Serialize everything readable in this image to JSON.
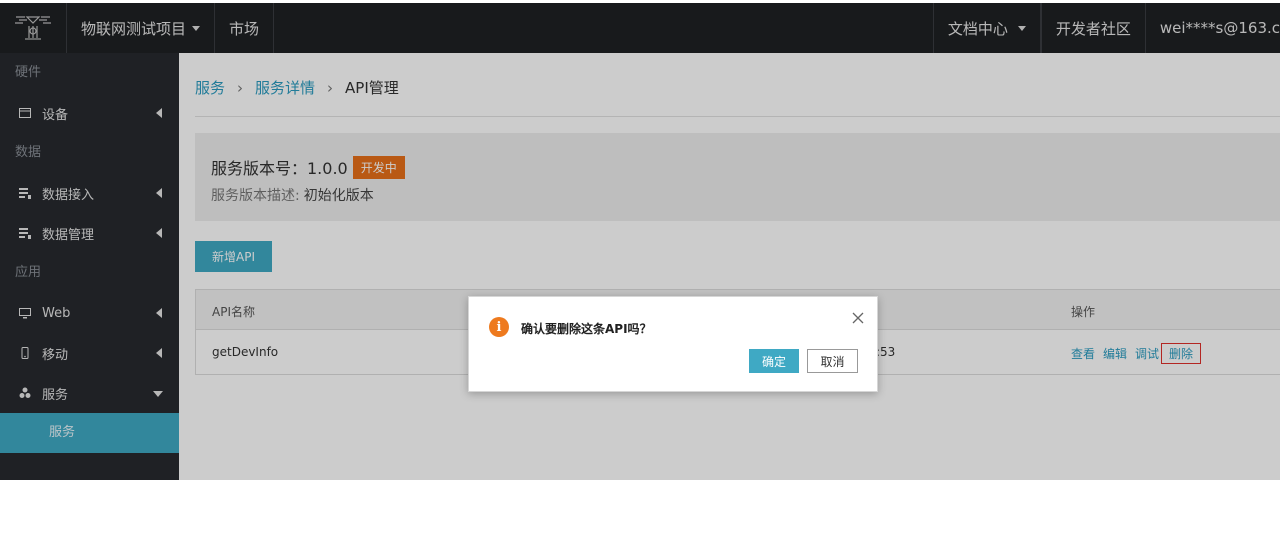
{
  "topbar": {
    "project_label": "物联网测试项目",
    "market_label": "市场",
    "docs_label": "文档中心",
    "community_label": "开发者社区",
    "user_label": "wei****s@163.c"
  },
  "sidebar": {
    "sections": {
      "hardware": "硬件",
      "data": "数据",
      "app": "应用"
    },
    "items": {
      "device": "设备",
      "data_access": "数据接入",
      "data_manage": "数据管理",
      "web": "Web",
      "mobile": "移动",
      "service": "服务",
      "service_sub": "服务"
    }
  },
  "breadcrumb": {
    "level1": "服务",
    "level2": "服务详情",
    "current": "API管理"
  },
  "version": {
    "label": "服务版本号：1.0.0",
    "status": "开发中",
    "desc_label": "服务版本描述:",
    "desc_value": "初始化版本"
  },
  "add_api_label": "新增API",
  "table": {
    "headers": {
      "name": "API名称",
      "ops": "操作"
    },
    "rows": [
      {
        "name": "getDevInfo",
        "time_partial": ":53"
      }
    ],
    "ops": {
      "view": "查看",
      "edit": "编辑",
      "debug": "调试",
      "delete": "删除"
    }
  },
  "dialog": {
    "icon_glyph": "i",
    "message": "确认要删除这条API吗？",
    "ok_label": "确定",
    "cancel_label": "取消"
  },
  "colors": {
    "accent": "#3fa9c4",
    "warning": "#e8701a",
    "sidebar_bg": "#272a2f",
    "topbar_bg": "#1f2124"
  }
}
